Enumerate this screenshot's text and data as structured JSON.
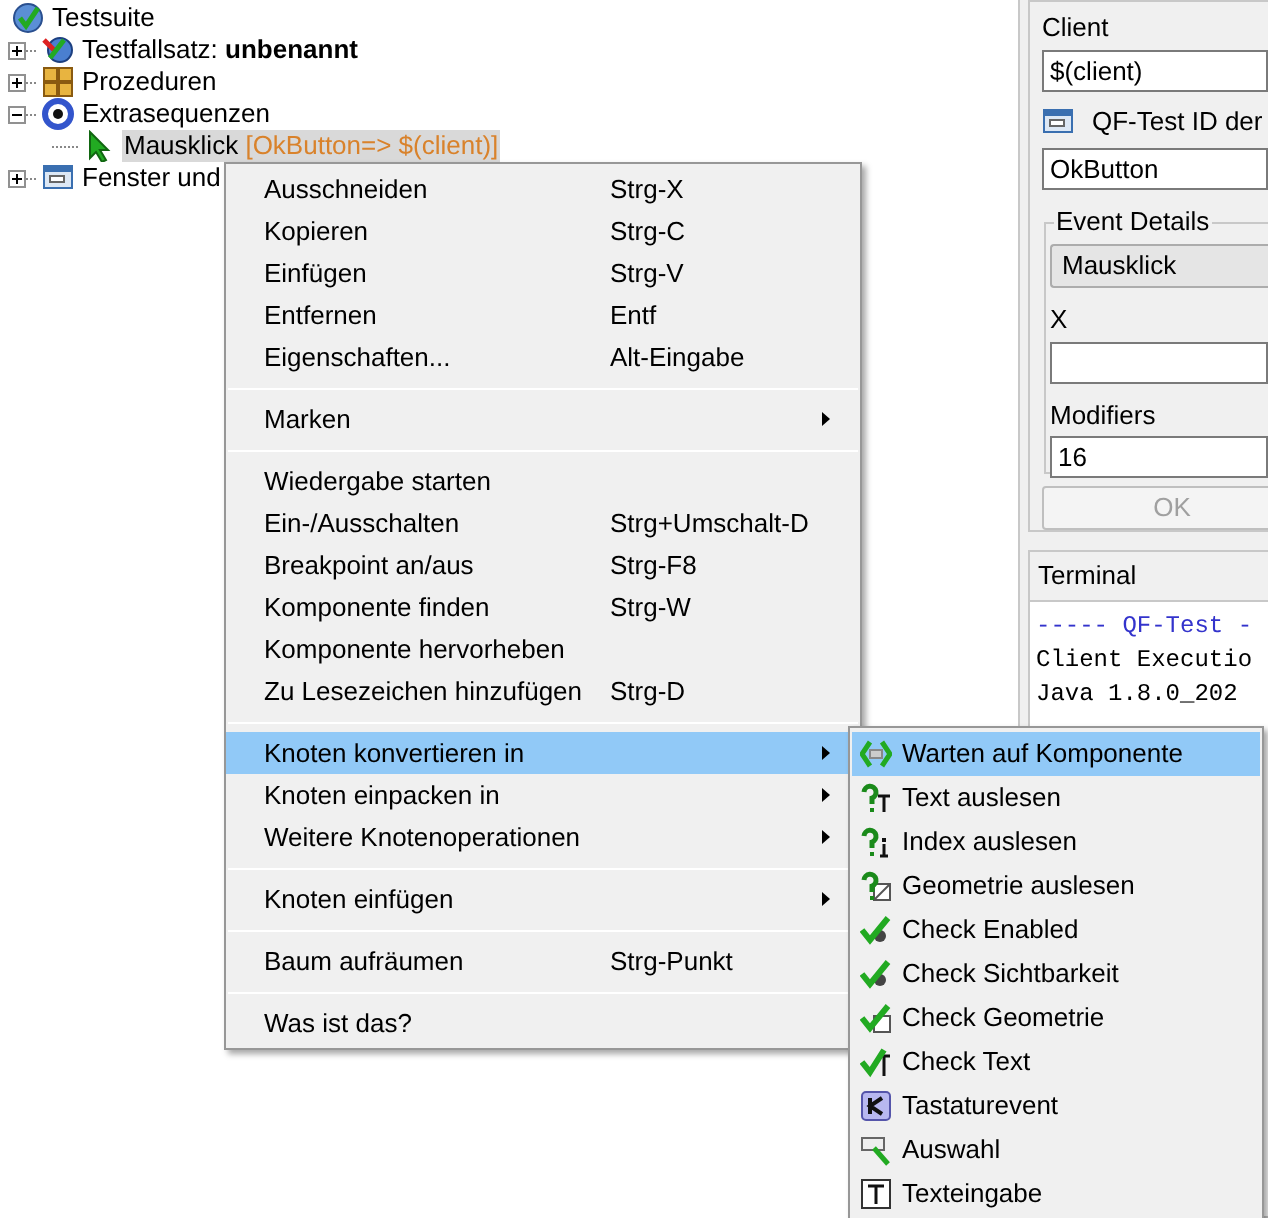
{
  "tree": {
    "label": "Testsuite",
    "kind": "suite",
    "children": [
      {
        "label": "Testfallsatz: **unbenannt**",
        "kind": "testset",
        "expanded": false,
        "selected": false
      },
      {
        "label": "Prozeduren",
        "kind": "procedures",
        "expanded": false,
        "selected": false
      },
      {
        "label": "Extrasequenzen",
        "kind": "extras",
        "expanded": true,
        "selected": false,
        "children": [
          {
            "label": "Mausklick",
            "detail": "[OkButton=> $(client)]",
            "kind": "mouse",
            "selected": true
          }
        ]
      },
      {
        "label": "Fenster und",
        "kind": "window",
        "expanded": false,
        "selected": false
      }
    ]
  },
  "details": {
    "client_label": "Client",
    "client_value": "$(client)",
    "component_label": "QF-Test ID der",
    "component_value": "OkButton",
    "event_group": "Event Details",
    "event_value": "Mausklick",
    "x_label": "X",
    "modifiers_label": "Modifiers",
    "modifiers_value": "16",
    "ok_button": {
      "label": "OK",
      "disabled": true
    }
  },
  "terminal": {
    "title": "Terminal",
    "lines": [
      {
        "text": "----- QF-Test -",
        "color": "#3333cc"
      },
      {
        "text": "Client Executio",
        "color": "#000000"
      },
      {
        "text": "Java 1.8.0_202",
        "color": "#000000"
      }
    ]
  },
  "context_menu": {
    "items": [
      {
        "kind": "item",
        "label": "Ausschneiden",
        "shortcut": "Strg-X",
        "selected": false
      },
      {
        "kind": "item",
        "label": "Kopieren",
        "shortcut": "Strg-C",
        "selected": false
      },
      {
        "kind": "item",
        "label": "Einfügen",
        "shortcut": "Strg-V",
        "selected": false
      },
      {
        "kind": "item",
        "label": "Entfernen",
        "shortcut": "Entf",
        "selected": false
      },
      {
        "kind": "item",
        "label": "Eigenschaften...",
        "shortcut": "Alt-Eingabe",
        "selected": false
      },
      {
        "kind": "separator"
      },
      {
        "kind": "submenu",
        "label": "Marken",
        "selected": false
      },
      {
        "kind": "separator"
      },
      {
        "kind": "item",
        "label": "Wiedergabe starten",
        "selected": false
      },
      {
        "kind": "item",
        "label": "Ein-/Ausschalten",
        "shortcut": "Strg+Umschalt-D",
        "selected": false
      },
      {
        "kind": "item",
        "label": "Breakpoint an/aus",
        "shortcut": "Strg-F8",
        "selected": false
      },
      {
        "kind": "item",
        "label": "Komponente finden",
        "shortcut": "Strg-W",
        "selected": false
      },
      {
        "kind": "item",
        "label": "Komponente hervorheben",
        "selected": false
      },
      {
        "kind": "item",
        "label": "Zu Lesezeichen hinzufügen",
        "shortcut": "Strg-D",
        "selected": false
      },
      {
        "kind": "separator"
      },
      {
        "kind": "submenu",
        "label": "Knoten konvertieren in",
        "selected": true
      },
      {
        "kind": "submenu",
        "label": "Knoten einpacken in",
        "selected": false
      },
      {
        "kind": "submenu",
        "label": "Weitere Knotenoperationen",
        "selected": false
      },
      {
        "kind": "separator"
      },
      {
        "kind": "submenu",
        "label": "Knoten einfügen",
        "selected": false
      },
      {
        "kind": "separator"
      },
      {
        "kind": "item",
        "label": "Baum aufräumen",
        "shortcut": "Strg-Punkt",
        "selected": false
      },
      {
        "kind": "separator"
      },
      {
        "kind": "item",
        "label": "Was ist das?",
        "selected": false
      }
    ]
  },
  "submenu": {
    "items": [
      {
        "label": "Warten auf Komponente",
        "kind": "wait",
        "selected": true
      },
      {
        "label": "Text auslesen",
        "kind": "fetch-text",
        "selected": false
      },
      {
        "label": "Index auslesen",
        "kind": "fetch-index",
        "selected": false
      },
      {
        "label": "Geometrie auslesen",
        "kind": "fetch-geometry",
        "selected": false
      },
      {
        "label": "Check Enabled",
        "kind": "check-dot",
        "selected": false
      },
      {
        "label": "Check Sichtbarkeit",
        "kind": "check-dot",
        "selected": false
      },
      {
        "label": "Check Geometrie",
        "kind": "check-geometry",
        "selected": false
      },
      {
        "label": "Check Text",
        "kind": "check-text",
        "selected": false
      },
      {
        "label": "Tastaturevent",
        "kind": "key",
        "selected": false
      },
      {
        "label": "Auswahl",
        "kind": "selection",
        "selected": false
      },
      {
        "label": "Texteingabe",
        "kind": "text-input",
        "selected": false
      }
    ]
  }
}
